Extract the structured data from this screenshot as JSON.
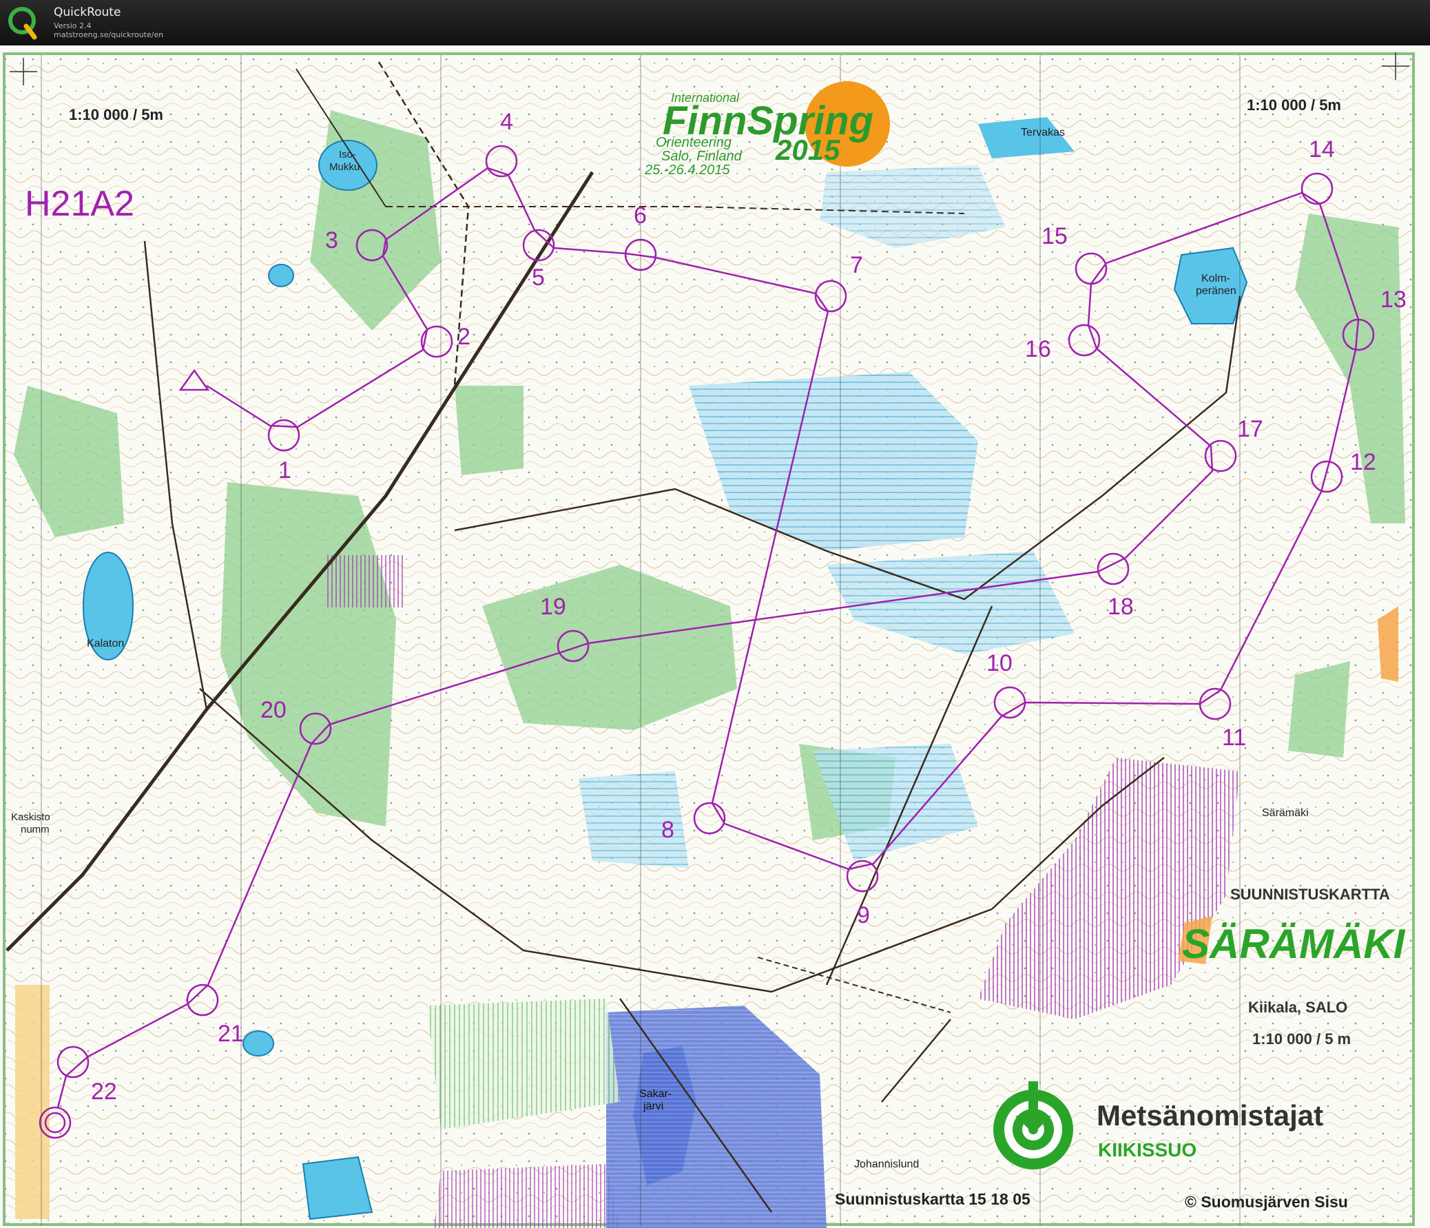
{
  "app": {
    "name": "QuickRoute",
    "version": "Versio 2.4",
    "url": "matstroeng.se/quickroute/en"
  },
  "map": {
    "scale_left": "1:10 000 / 5m",
    "scale_right": "1:10 000 / 5m",
    "course_class": "H21A2",
    "event": {
      "line1": "International",
      "line2": "FinnSpring",
      "line3": "2015",
      "line4": "Orienteering",
      "line5": "Salo, Finland",
      "line6": "25.-26.4.2015"
    },
    "place_names": {
      "iso_mukku_1": "Iso-",
      "iso_mukku_2": "Mukku",
      "kalaton": "Kalaton",
      "tervakas": "Tervakas",
      "kolmperanen_1": "Kolm-",
      "kolmperanen_2": "peränen",
      "kaskisto_1": "Kaskisto",
      "kaskisto_2": "numm",
      "saramaki_small": "Särämäki",
      "sakarjarvi_1": "Sakar-",
      "sakarjarvi_2": "järvi",
      "johannislund": "Johannislund"
    },
    "legend": {
      "map_type": "SUUNNISTUSKARTTA",
      "map_name": "SÄRÄMÄKI",
      "location": "Kiikala, SALO",
      "scale": "1:10 000 / 5 m",
      "sponsor_name": "Metsänomistajat",
      "sponsor_sub": "KIIKISSUO",
      "map_number": "Suunnistuskartta 15 18 05",
      "copyright": "© Suomusjärven Sisu"
    },
    "controls": [
      {
        "num": "1"
      },
      {
        "num": "2"
      },
      {
        "num": "3"
      },
      {
        "num": "4"
      },
      {
        "num": "5"
      },
      {
        "num": "6"
      },
      {
        "num": "7"
      },
      {
        "num": "8"
      },
      {
        "num": "9"
      },
      {
        "num": "10"
      },
      {
        "num": "11"
      },
      {
        "num": "12"
      },
      {
        "num": "13"
      },
      {
        "num": "14"
      },
      {
        "num": "15"
      },
      {
        "num": "16"
      },
      {
        "num": "17"
      },
      {
        "num": "18"
      },
      {
        "num": "19"
      },
      {
        "num": "20"
      },
      {
        "num": "21"
      },
      {
        "num": "22"
      }
    ],
    "colors": {
      "course": "#a020b0",
      "water": "#59c3e8",
      "forest_green": "#78c878",
      "event_orange": "#f39a1c",
      "event_green": "#2e9a2e",
      "sponsor_green": "#2aa52a"
    }
  }
}
